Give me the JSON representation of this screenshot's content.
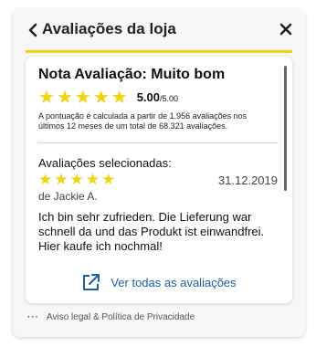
{
  "header": {
    "title": "Avaliações da loja",
    "back_icon": "chevron-left-icon",
    "close_icon": "close-icon"
  },
  "summary": {
    "title": "Nota Avaliação: Muito bom",
    "stars": 5,
    "score": "5.00",
    "score_max": "/5.00",
    "note": "A pontuação é calculada a partir de 1.956 avaliações nos últimos 12 meses de um total de 68.321 avaliações."
  },
  "reviews": {
    "section_title": "Avaliações selecionadas:",
    "items": [
      {
        "stars": 5,
        "date": "31.12.2019",
        "author": "de Jackie A.",
        "text": "Ich bin sehr zufrieden. Die Lieferung war schnell da und das Produkt ist einwandfrei. Hier kaufe ich nochmal!"
      }
    ]
  },
  "footer": {
    "link_label": "Ver todas as avaliações",
    "link_icon": "external-link-icon"
  },
  "legal": {
    "dots": "···",
    "text": "Aviso legal & Política de Privacidade"
  },
  "colors": {
    "star": "#f1d40e",
    "accent_line": "#f1d40e",
    "link": "#1a5fa8"
  }
}
